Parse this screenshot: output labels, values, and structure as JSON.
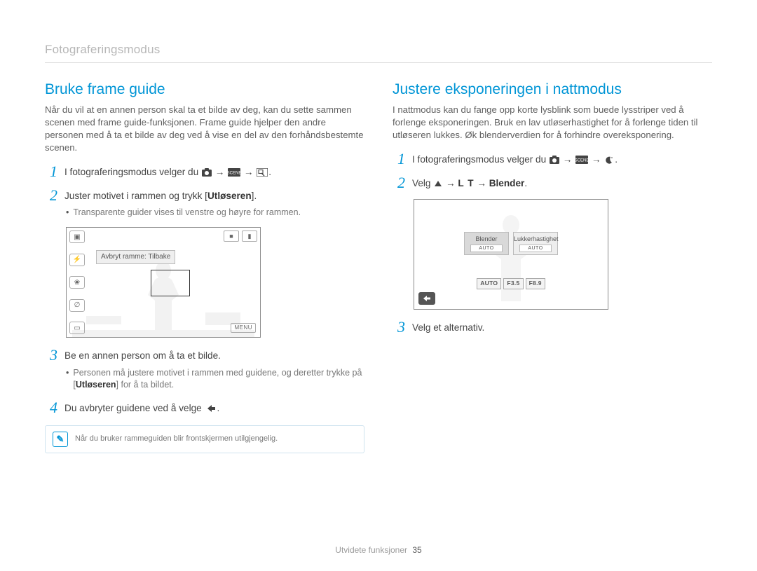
{
  "section_label": "Fotograferingsmodus",
  "left": {
    "heading": "Bruke frame guide",
    "intro": "Når du vil at en annen person skal ta et bilde av deg, kan du sette sammen scenen med frame guide-funksjonen. Frame guide hjelper den andre personen med å ta et bilde av deg ved å vise en del av den forhåndsbestemte scenen.",
    "step1_prefix": "I fotograferingsmodus velger du ",
    "step2_prefix": "Juster motivet i rammen og trykk [",
    "step2_bold": "Utløseren",
    "step2_suffix": "].",
    "step2_bullet": "Transparente guider vises til venstre og høyre for rammen.",
    "screen_label": "Avbryt ramme: Tilbake",
    "screen_menu": "MENU",
    "step3_text": "Be en annen person om å ta et bilde.",
    "step3_bullet_pre": "Personen må justere motivet i rammen med guidene, og deretter trykke på [",
    "step3_bullet_bold": "Utløseren",
    "step3_bullet_post": "] for å ta bildet.",
    "step4_text": "Du avbryter guidene ved å velge ",
    "note": "Når du bruker rammeguiden blir frontskjermen utilgjengelig."
  },
  "right": {
    "heading": "Justere eksponeringen i nattmodus",
    "intro": "I nattmodus kan du fange opp korte lysblink som buede lysstriper ved å forlenge eksponeringen. Bruk en lav utløserhastighet for å forlenge tiden til utløseren lukkes. Øk blenderverdien for å forhindre overeksponering.",
    "step1_prefix": "I fotograferingsmodus velger du ",
    "step2_prefix": "Velg ",
    "step2_lt": "L T",
    "step2_bold": "Blender",
    "tabs": {
      "left_label": "Blender",
      "right_label": "Lukkerhastighet",
      "sub": "AUTO"
    },
    "vals": [
      "AUTO",
      "F3.5",
      "F8.9"
    ],
    "step3_text": "Velg et alternativ."
  },
  "nums": {
    "1": "1",
    "2": "2",
    "3": "3",
    "4": "4"
  },
  "footer_label": "Utvidete funksjoner",
  "page_number": "35",
  "arrow": "→",
  "period": "."
}
